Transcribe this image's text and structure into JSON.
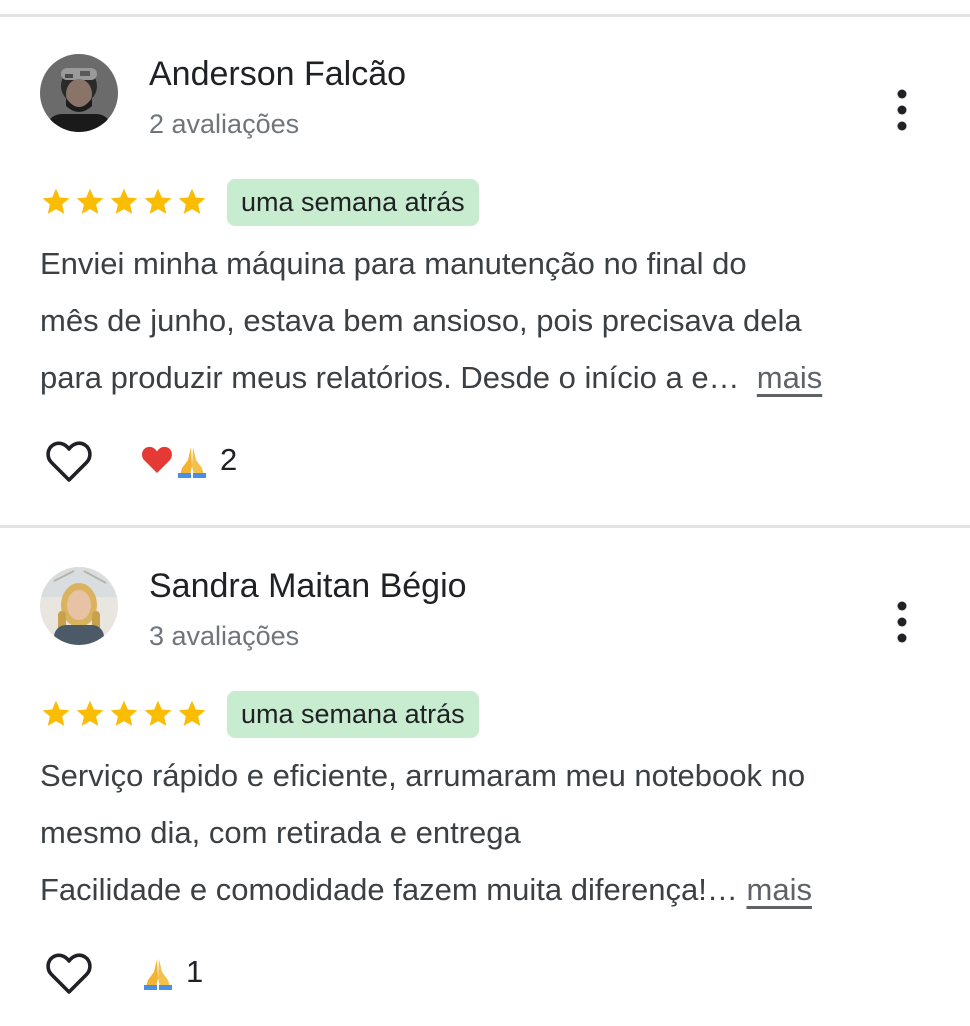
{
  "reviews": [
    {
      "author": "Anderson Falcão",
      "review_count": "2 avaliações",
      "rating": 5,
      "time": "uma semana atrás",
      "text_lines": [
        "Enviei minha máquina para manutenção no final do",
        "mês de junho, estava bem ansioso, pois precisava dela",
        "para produzir meus relatórios. Desde o início a e…"
      ],
      "more_label": "mais",
      "reactions": [
        "heart-emoji",
        "folded-hands-emoji"
      ],
      "reaction_count": "2"
    },
    {
      "author": "Sandra Maitan Bégio",
      "review_count": "3 avaliações",
      "rating": 5,
      "time": "uma semana atrás",
      "text_lines": [
        "Serviço rápido e eficiente, arrumaram meu notebook no",
        "mesmo dia, com retirada e entrega",
        "Facilidade e comodidade fazem muita diferença!…"
      ],
      "more_label": "mais",
      "reactions": [
        "folded-hands-emoji"
      ],
      "reaction_count": "1"
    }
  ],
  "colors": {
    "star": "#fbbc04",
    "badge_bg": "#c8eccf",
    "secondary_text": "#70757a",
    "divider": "#e3e3e3"
  }
}
